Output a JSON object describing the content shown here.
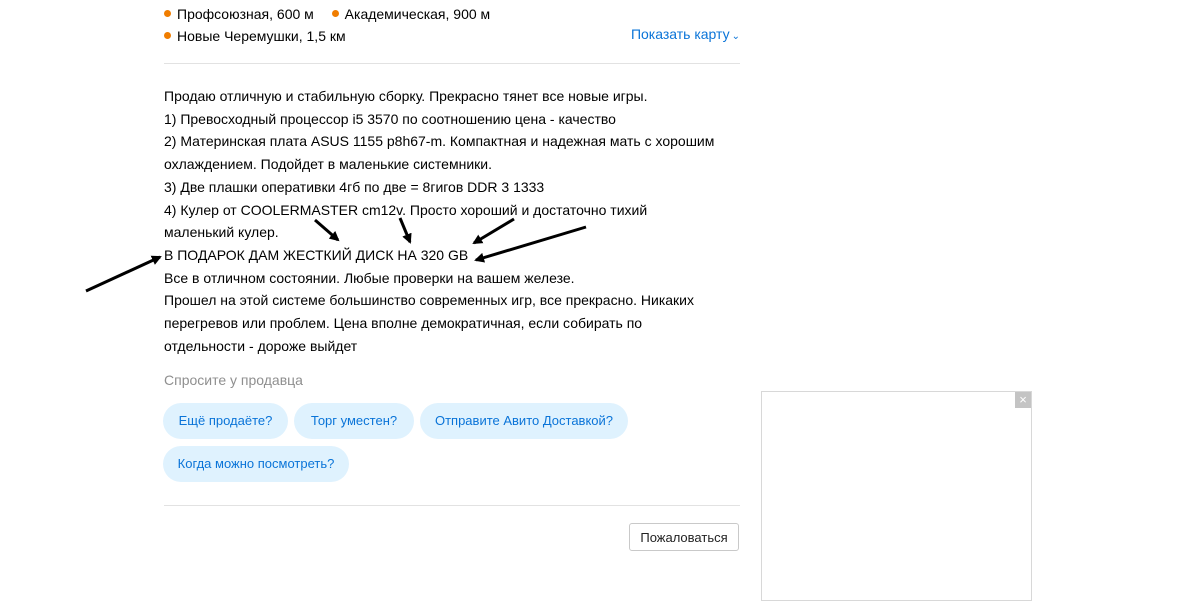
{
  "metro": {
    "row1": [
      {
        "name": "Профсоюзная",
        "distance": "600 м"
      },
      {
        "name": "Академическая",
        "distance": "900 м"
      }
    ],
    "row2": [
      {
        "name": "Новые Черемушки",
        "distance": "1,5 км"
      }
    ],
    "dot_color": "#f07d00"
  },
  "map_link": {
    "label": "Показать карту",
    "icon": "chevron-down-icon"
  },
  "description": {
    "lines": [
      "Продаю отличную и стабильную сборку. Прекрасно тянет все новые игры.",
      "1) Превосходный процессор i5 3570 по соотношению цена - качество",
      "2) Материнская плата ASUS 1155 p8h67-m. Компактная и надежная мать с хорошим",
      "охлаждением. Подойдет в маленькие системники.",
      "3) Две плашки оперативки 4гб по две = 8гигов DDR 3 1333",
      "4) Кулер от COOLERMASTER cm12v. Просто хороший и достаточно тихий",
      "маленький кулер.",
      "В ПОДАРОК ДАМ ЖЕСТКИЙ ДИСК НА 320 GB",
      "Все в отличном состоянии. Любые проверки на вашем железе.",
      "Прошел на этой системе большинство современных игр, все прекрасно. Никаких",
      "перегревов или проблем. Цена вполне демократичная, если собирать по",
      "отдельности - дороже выйдет"
    ]
  },
  "ask_seller": {
    "title": "Спросите у продавца",
    "chips": [
      "Ещё продаёте?",
      "Торг уместен?",
      "Отправите Авито Доставкой?",
      "Когда можно посмотреть?"
    ]
  },
  "report_button": {
    "label": "Пожаловаться"
  },
  "ad_close": {
    "label": "×"
  },
  "annotation_arrows": {
    "count": 5,
    "color": "#000000"
  },
  "colors": {
    "link": "#0a74d8",
    "chip_bg": "#dff2fe",
    "muted": "#8f8f8f"
  }
}
